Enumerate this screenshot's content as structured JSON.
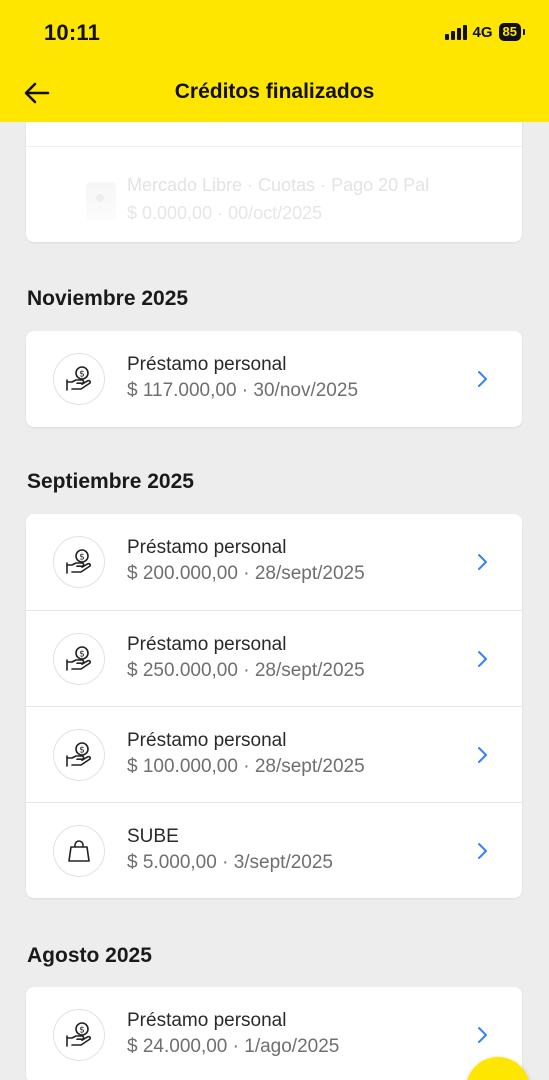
{
  "status_bar": {
    "time": "10:11",
    "network": "4G",
    "battery": "85"
  },
  "header": {
    "title": "Créditos finalizados",
    "back_icon": "arrow-left-icon",
    "bg_color": "#ffe600"
  },
  "faded_top": {
    "title": "Mercado Libre · Cuotas · Pago 20 Pal",
    "subtitle": "$ 0.000,00 · 00/oct/2025"
  },
  "sections": [
    {
      "title": "Noviembre 2025",
      "items": [
        {
          "icon": "hand-money-icon",
          "title": "Préstamo personal",
          "subtitle": "$ 117.000,00 · 30/nov/2025"
        }
      ]
    },
    {
      "title": "Septiembre 2025",
      "items": [
        {
          "icon": "hand-money-icon",
          "title": "Préstamo personal",
          "subtitle": "$ 200.000,00 · 28/sept/2025"
        },
        {
          "icon": "hand-money-icon",
          "title": "Préstamo personal",
          "subtitle": "$ 250.000,00 · 28/sept/2025"
        },
        {
          "icon": "hand-money-icon",
          "title": "Préstamo personal",
          "subtitle": "$ 100.000,00 · 28/sept/2025"
        },
        {
          "icon": "shopping-bag-icon",
          "title": "SUBE",
          "subtitle": "$ 5.000,00 · 3/sept/2025"
        }
      ]
    },
    {
      "title": "Agosto 2025",
      "items": [
        {
          "icon": "hand-money-icon",
          "title": "Préstamo personal",
          "subtitle": "$ 24.000,00 · 1/ago/2025"
        }
      ]
    }
  ],
  "colors": {
    "accent_yellow": "#ffe600",
    "chevron_blue": "#3483fa",
    "background": "#ededed"
  }
}
